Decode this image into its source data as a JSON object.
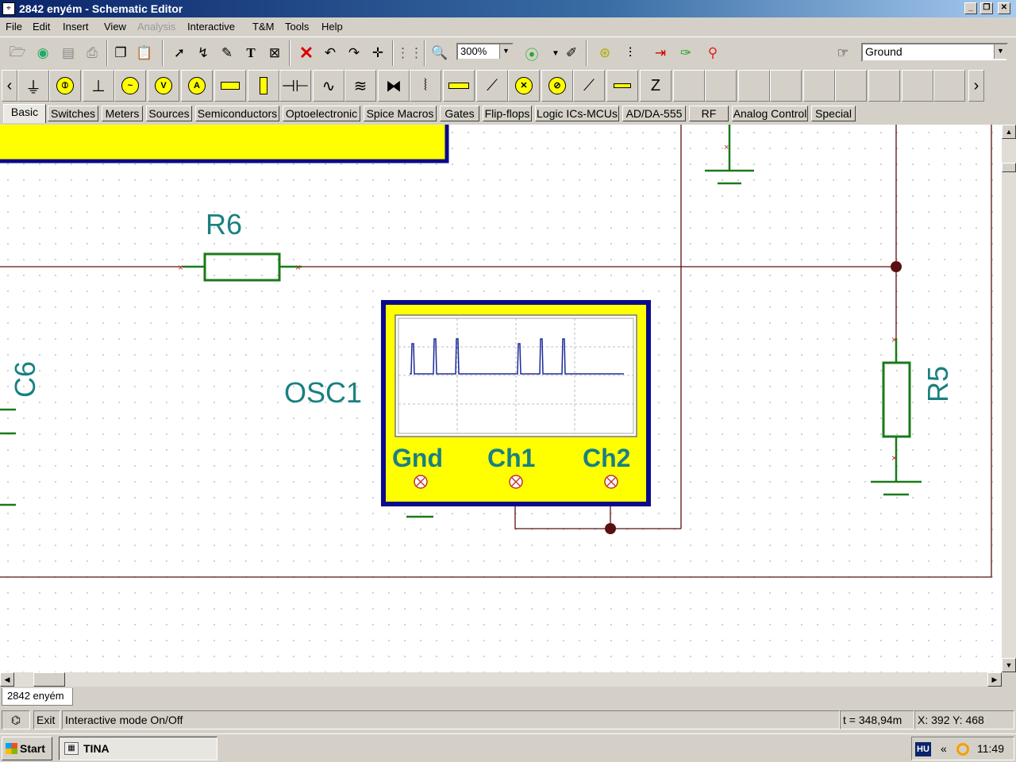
{
  "window": {
    "title": "2842 enyém - Schematic Editor",
    "min_label": "_",
    "max_label": "❐",
    "close_label": "✕"
  },
  "menu": [
    "File",
    "Edit",
    "Insert",
    "View",
    "Analysis",
    "Interactive",
    "T&M",
    "Tools",
    "Help"
  ],
  "menu_disabled": "Analysis",
  "toolbar": {
    "zoom": "300%",
    "ground_combo": "Ground"
  },
  "tabs": [
    "Basic",
    "Switches",
    "Meters",
    "Sources",
    "Semiconductors",
    "Optoelectronic",
    "Spice Macros",
    "Gates",
    "Flip-flops",
    "Logic ICs-MCUs",
    "AD/DA-555",
    "RF",
    "Analog Control",
    "Special"
  ],
  "schematic": {
    "r6": "R6",
    "r5": "R5",
    "c6": "C6",
    "osc": "OSC1",
    "osc_gnd": "Gnd",
    "osc_ch1": "Ch1",
    "osc_ch2": "Ch2"
  },
  "document_tab": "2842 enyém",
  "status": {
    "exit": "Exit",
    "message": "Interactive mode On/Off",
    "time": "t = 348,94m",
    "coords": "X: 392  Y: 468"
  },
  "taskbar": {
    "start": "Start",
    "task": "TINA",
    "lang": "HU",
    "chevron": "«",
    "clock": "11:49"
  },
  "colors": {
    "wire": "#5a1010",
    "component": "#1a7a1a",
    "label": "#1a8080",
    "osc_fill": "#ffff00",
    "osc_border": "#0a0a8a",
    "trace": "#1a2a9a"
  }
}
